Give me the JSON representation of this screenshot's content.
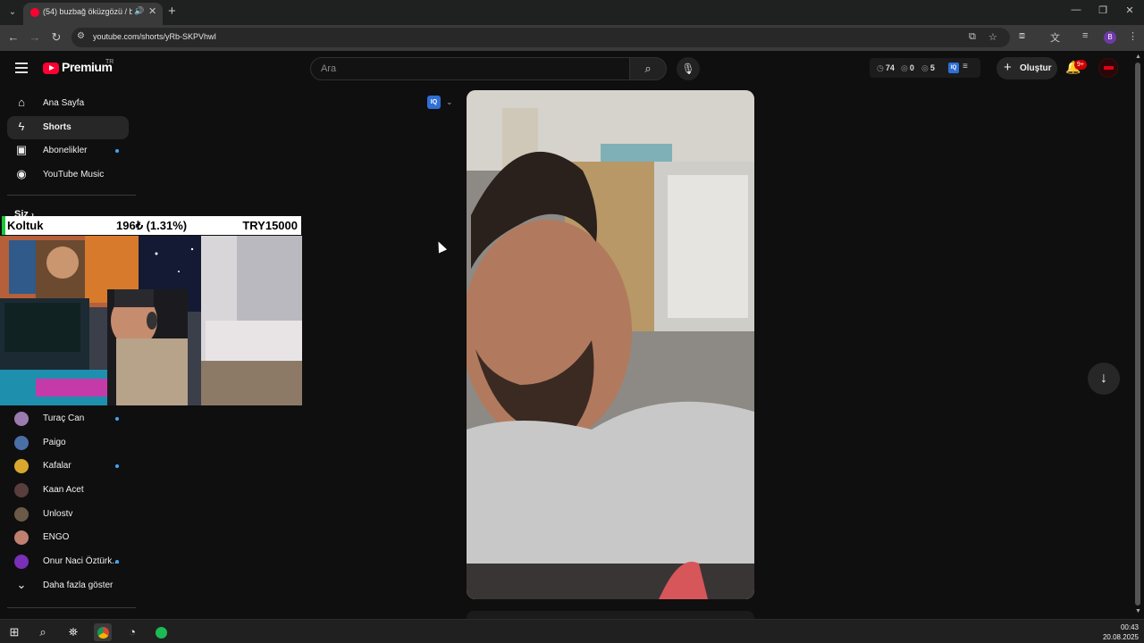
{
  "browser": {
    "tab": {
      "title": "(54) buzbağ öküzgözü / bo"
    },
    "url": "youtube.com/shorts/yRb-SKPVhwI",
    "profile_initial": "B"
  },
  "masthead": {
    "brand": "Premium",
    "country": "TR",
    "search_placeholder": "Ara",
    "stats": {
      "views": "74",
      "likes": "0",
      "comments": "5"
    },
    "iq_badge": "IQ",
    "create_label": "Oluştur",
    "notif_count": "9+"
  },
  "sidebar": {
    "main": [
      {
        "label": "Ana Sayfa",
        "icon": "home-icon"
      },
      {
        "label": "Shorts",
        "icon": "shorts-icon",
        "active": true
      },
      {
        "label": "Abonelikler",
        "icon": "subscriptions-icon"
      },
      {
        "label": "YouTube Music",
        "icon": "music-icon"
      }
    ],
    "you_label": "Siz",
    "subscriptions": [
      {
        "name": "Turaç Can",
        "color": "#9a7bb0"
      },
      {
        "name": "Paigo",
        "color": "#4a6fa5"
      },
      {
        "name": "Kafalar",
        "color": "#d9a62e"
      },
      {
        "name": "Kaan Acet",
        "color": "#5a3d3d"
      },
      {
        "name": "Unlostv",
        "color": "#6b5a48"
      },
      {
        "name": "ENGO",
        "color": "#c08070"
      },
      {
        "name": "Onur Naci Öztürk...",
        "color": "#7a2fb8"
      }
    ],
    "show_more": "Daha fazla göster"
  },
  "ticker": {
    "name": "Koltuk",
    "change": "196₺ (1.31%)",
    "value": "TRY15000",
    "up_color": "#1ac63a"
  },
  "taskbar": {
    "time": "00:43",
    "date": "20.08.2025"
  }
}
